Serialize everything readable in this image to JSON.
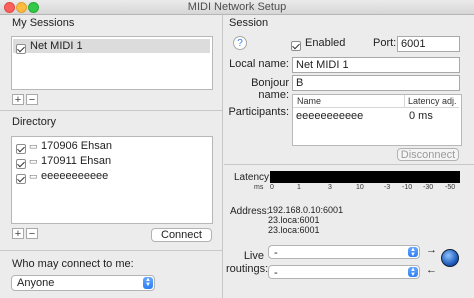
{
  "window": {
    "title": "MIDI Network Setup"
  },
  "sessions": {
    "label": "My Sessions",
    "items": [
      {
        "name": "Net MIDI 1",
        "checked": true
      }
    ],
    "add_label": "+",
    "remove_label": "−"
  },
  "directory": {
    "label": "Directory",
    "items": [
      {
        "name": "170906 Ehsan",
        "checked": true
      },
      {
        "name": "170911 Ehsan",
        "checked": true
      },
      {
        "name": "eeeeeeeeeee",
        "checked": true
      }
    ],
    "add_label": "+",
    "remove_label": "−",
    "connect_label": "Connect"
  },
  "who": {
    "label": "Who may connect to me:",
    "value": "Anyone"
  },
  "session": {
    "label": "Session",
    "help_label": "?",
    "enabled_label": "Enabled",
    "enabled": true,
    "port_label": "Port:",
    "port_value": "6001",
    "local_name_label": "Local name:",
    "local_name_value": "Net MIDI 1",
    "bonjour_label": "Bonjour name:",
    "bonjour_value": "B",
    "participants_label": "Participants:",
    "participants_headers": {
      "name": "Name",
      "latency": "Latency adj."
    },
    "participants": [
      {
        "name": "eeeeeeeeeee",
        "latency": "0 ms"
      }
    ],
    "disconnect_label": "Disconnect",
    "latency_label": "Latency:",
    "latency_unit": "ms",
    "latency_ticks": [
      "0",
      "1",
      "3",
      "10",
      "-3",
      "-10",
      "-30",
      "-50"
    ],
    "address_label": "Address:",
    "addresses": [
      "192.168.0.10:6001",
      "23.loca:6001",
      "23.loca:6001"
    ],
    "live_routings_label": [
      "Live",
      "routings:"
    ],
    "routing_in_value": "-",
    "routing_out_value": "-"
  },
  "colors": {
    "accent": "#2e7ff4",
    "meter": "#000000"
  }
}
